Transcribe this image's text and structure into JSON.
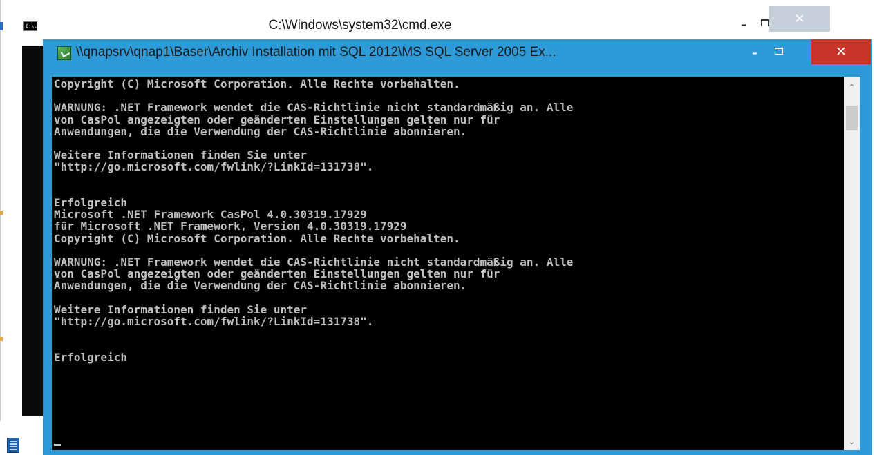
{
  "back_window": {
    "title": "C:\\Windows\\system32\\cmd.exe",
    "icon_text": "C:\\.",
    "minimize_glyph": "–",
    "close_glyph": "✕"
  },
  "front_window": {
    "title": "\\\\qnapsrv\\qnap1\\Baser\\Archiv Installation mit SQL 2012\\MS SQL Server 2005 Ex...",
    "minimize_glyph": "–",
    "close_glyph": "✕",
    "console_text": "Copyright (C) Microsoft Corporation. Alle Rechte vorbehalten.\n\nWARNUNG: .NET Framework wendet die CAS-Richtlinie nicht standardmäßig an. Alle\nvon CasPol angezeigten oder geänderten Einstellungen gelten nur für\nAnwendungen, die die Verwendung der CAS-Richtlinie abonnieren.\n\nWeitere Informationen finden Sie unter\n\"http://go.microsoft.com/fwlink/?LinkId=131738\".\n\n\nErfolgreich\nMicrosoft .NET Framework CasPol 4.0.30319.17929\nfür Microsoft .NET Framework, Version 4.0.30319.17929\nCopyright (C) Microsoft Corporation. Alle Rechte vorbehalten.\n\nWARNUNG: .NET Framework wendet die CAS-Richtlinie nicht standardmäßig an. Alle\nvon CasPol angezeigten oder geänderten Einstellungen gelten nur für\nAnwendungen, die die Verwendung der CAS-Richtlinie abonnieren.\n\nWeitere Informationen finden Sie unter\n\"http://go.microsoft.com/fwlink/?LinkId=131738\".\n\n\nErfolgreich",
    "scroll_up_glyph": "⌃",
    "scroll_down_glyph": "⌄"
  },
  "colors": {
    "frame_accent": "#2e9bd8",
    "close_button": "#c7352b",
    "console_bg": "#000000",
    "console_fg": "#c0c0c0"
  }
}
